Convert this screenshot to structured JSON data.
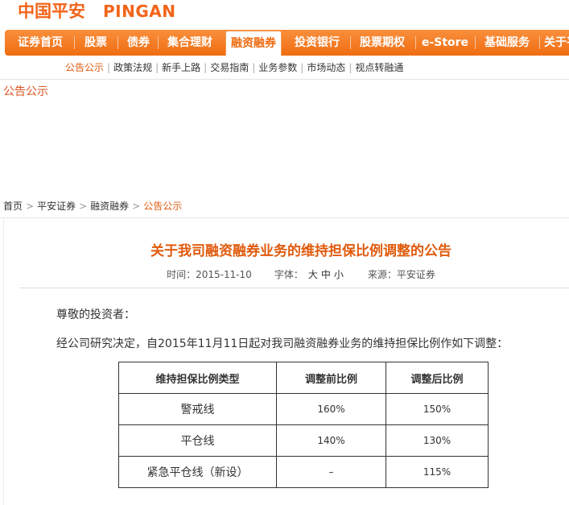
{
  "brand": {
    "cn": "中国平安",
    "en": "PINGAN",
    "color": "#f26419"
  },
  "nav": {
    "items": [
      {
        "label": "证券首页"
      },
      {
        "label": "股票"
      },
      {
        "label": "债券"
      },
      {
        "label": "集合理财"
      },
      {
        "label": "融资融券",
        "active": true
      },
      {
        "label": "投资银行"
      },
      {
        "label": "股票期权"
      },
      {
        "label": "e-Store"
      },
      {
        "label": "基础服务"
      },
      {
        "label": "关于平"
      }
    ]
  },
  "subnav": {
    "items": [
      {
        "label": "公告公示",
        "active": true
      },
      {
        "label": "政策法规"
      },
      {
        "label": "新手上路"
      },
      {
        "label": "交易指南"
      },
      {
        "label": "业务参数"
      },
      {
        "label": "市场动态"
      },
      {
        "label": "视点转融通"
      }
    ],
    "separator": "|"
  },
  "section_title": "公告公示",
  "breadcrumb": {
    "items": [
      "首页",
      "平安证券",
      "融资融券",
      "公告公示"
    ],
    "arrow": ">"
  },
  "article": {
    "title": "关于我司融资融券业务的维持担保比例调整的公告",
    "time_label": "时间：",
    "time": "2015-11-10",
    "font_label": "字体：",
    "font_sizes": [
      "大",
      "中",
      "小"
    ],
    "source_label": "来源：",
    "source": "平安证券",
    "greeting": "尊敬的投资者：",
    "intro": "经公司研究决定，自2015年11月11日起对我司融资融券业务的维持担保比例作如下调整：",
    "table": {
      "headers": [
        "维持担保比例类型",
        "调整前比例",
        "调整后比例"
      ],
      "rows": [
        [
          "警戒线",
          "160%",
          "150%"
        ],
        [
          "平仓线",
          "140%",
          "130%"
        ],
        [
          "紧急平仓线（新设）",
          "–",
          "115%"
        ]
      ]
    }
  },
  "colors": {
    "accent": "#ef6c10",
    "link_active": "#e05a0c"
  }
}
